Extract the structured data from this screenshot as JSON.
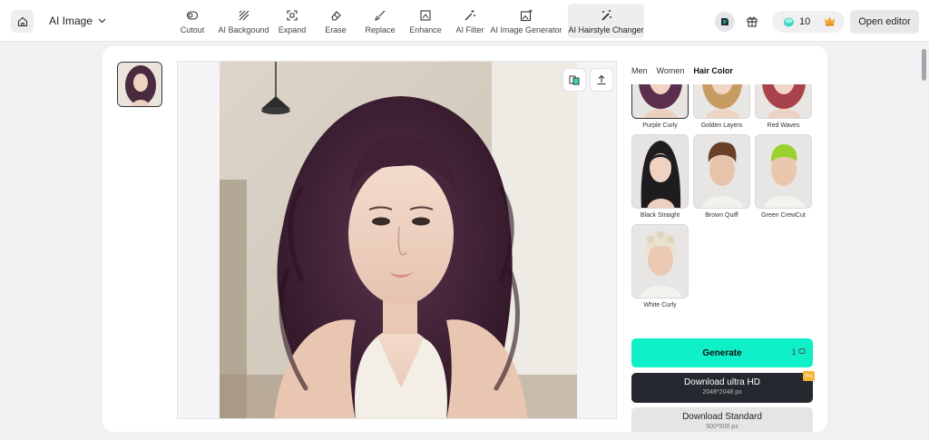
{
  "topbar": {
    "app_menu_label": "AI Image",
    "tools": [
      {
        "label": "Cutout",
        "icon": "cutout-icon"
      },
      {
        "label": "AI Backgound",
        "icon": "background-icon"
      },
      {
        "label": "Expand",
        "icon": "expand-icon"
      },
      {
        "label": "Erase",
        "icon": "eraser-icon"
      },
      {
        "label": "Replace",
        "icon": "brush-icon"
      },
      {
        "label": "Enhance",
        "icon": "enhance-icon"
      },
      {
        "label": "AI Filter",
        "icon": "wand-icon"
      },
      {
        "label": "AI Image Generator",
        "icon": "image-sparkle-icon"
      },
      {
        "label": "AI Hairstyle Changer",
        "icon": "magic-wand-icon",
        "active": true
      }
    ],
    "credits": "10",
    "open_editor_label": "Open editor"
  },
  "panel": {
    "tabs": [
      "Men",
      "Women",
      "Hair Color"
    ],
    "active_tab": "Hair Color",
    "styles": [
      {
        "label": "Purple Curly",
        "selected": true
      },
      {
        "label": "Golden Layers"
      },
      {
        "label": "Red Waves"
      },
      {
        "label": "Black Straight"
      },
      {
        "label": "Brown Quiff"
      },
      {
        "label": "Green CrewCut"
      },
      {
        "label": "White Curly"
      }
    ],
    "generate_label": "Generate",
    "generate_cost": "1",
    "download_hd_label": "Download ultra HD",
    "download_hd_size": "2048*2048 px",
    "pro_tag": "Pro",
    "download_std_label": "Download Standard",
    "download_std_size": "500*500 px"
  },
  "colors": {
    "accent": "#10f0c8",
    "dark_button": "#25282f",
    "hair_purple": "#4a2a3f"
  }
}
